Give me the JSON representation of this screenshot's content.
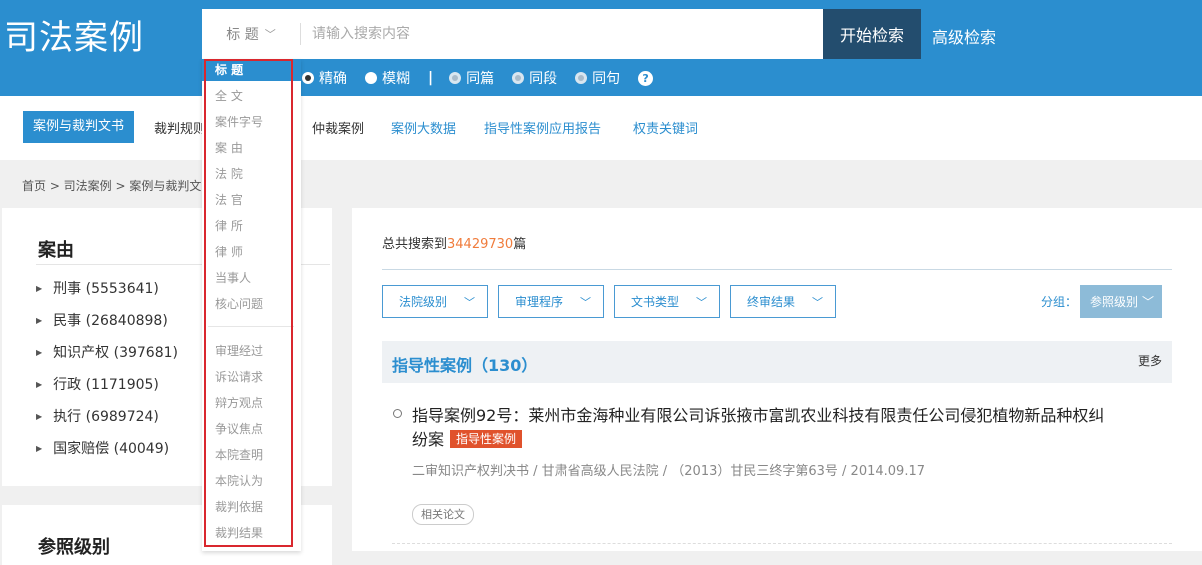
{
  "header": {
    "logo": "司法案例",
    "search": {
      "field": "标 题",
      "placeholder": "请输入搜索内容",
      "button": "开始检索"
    },
    "advanced": "高级检索",
    "options": [
      {
        "label": "精确",
        "checked": true
      },
      {
        "label": "模糊",
        "checked": false
      },
      {
        "label": "同篇",
        "checked": false,
        "dim": true
      },
      {
        "label": "同段",
        "checked": false,
        "dim": true
      },
      {
        "label": "同句",
        "checked": false,
        "dim": true
      }
    ],
    "separator": "|",
    "help": "?"
  },
  "nav": {
    "items": [
      "案例与裁判文书",
      "裁判规则",
      "仲裁案例",
      "案例大数据",
      "指导性案例应用报告",
      "权责关键词"
    ]
  },
  "breadcrumb": "首页 > 司法案例 > 案例与裁判文书",
  "left": {
    "title": "案由",
    "items": [
      "刑事 (5553641)",
      "民事 (26840898)",
      "知识产权 (397681)",
      "行政 (1171905)",
      "执行 (6989724)",
      "国家赔偿 (40049)"
    ],
    "title2": "参照级别"
  },
  "dropdown": {
    "items": [
      "标 题",
      "全 文",
      "案件字号",
      "案 由",
      "法 院",
      "法 官",
      "律 所",
      "律 师",
      "当事人",
      "核心问题"
    ],
    "items2": [
      "审理经过",
      "诉讼请求",
      "辩方观点",
      "争议焦点",
      "本院查明",
      "本院认为",
      "裁判依据",
      "裁判结果"
    ]
  },
  "main": {
    "total_prefix": "总共搜索到",
    "total_count": "34429730",
    "total_suffix": "篇",
    "filters": [
      "法院级别",
      "审理程序",
      "文书类型",
      "终审结果"
    ],
    "group_label": "分组：",
    "group_value": "参照级别",
    "section_title": "指导性案例（130）",
    "more": "更多",
    "case": {
      "title": "指导案例92号：莱州市金海种业有限公司诉张掖市富凯农业科技有限责任公司侵犯植物新品种权纠纷案",
      "tag": "指导性案例",
      "meta": "二审知识产权判决书 / 甘肃省高级人民法院 / （2013）甘民三终字第63号 / 2014.09.17",
      "related": "相关论文"
    }
  },
  "colors": {
    "primary": "#2b8ecf",
    "dark_button": "#234d6e",
    "tag": "#e0522c",
    "count": "#f07c3c",
    "highlight_box": "#d9272e"
  }
}
